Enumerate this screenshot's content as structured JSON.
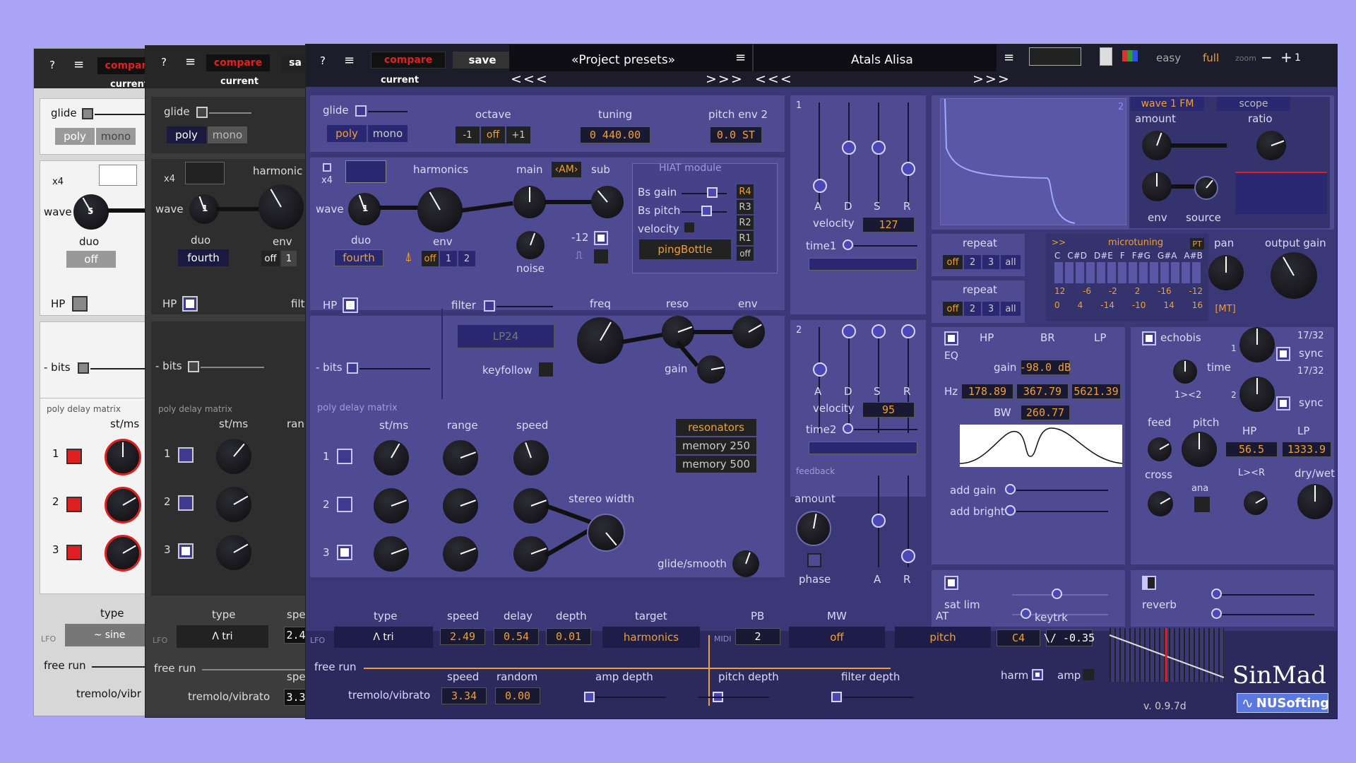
{
  "header": {
    "help": "?",
    "menu": "≡",
    "compare": "compare",
    "save": "save",
    "current": "current",
    "presets_bank": "«Project presets»",
    "preset_name": "Atals Alisa",
    "prev": "<<<",
    "next": ">>>",
    "easy": "easy",
    "full": "full",
    "zoom": "zoom",
    "zoom_out": "−",
    "zoom_in": "+",
    "zoom_val": "1"
  },
  "osc": {
    "glide": "glide",
    "poly": "poly",
    "mono": "mono",
    "octave": "octave",
    "oct_minus": "-1",
    "oct_off": "off",
    "oct_plus": "+1",
    "tuning": "tuning",
    "tuning_val": "0 440.00",
    "pitch_env": "pitch env 2",
    "pitch_env_val": "0.0 ST",
    "x4": "x4",
    "harmonics": "harmonics",
    "main": "main",
    "am": "‹AM›",
    "sub": "sub",
    "wave": "wave",
    "wave_num": "1",
    "duo": "duo",
    "duo_val": "fourth",
    "env": "env",
    "env_off": "off",
    "env_1": "1",
    "env_2": "2",
    "noise": "noise",
    "minus12": "-12"
  },
  "hiat": {
    "title": "HIAT module",
    "bs_gain": "Bs gain",
    "bs_pitch": "Bs pitch",
    "velocity": "velocity",
    "r4": "R4",
    "r3": "R3",
    "r2": "R2",
    "r1": "R1",
    "off": "off",
    "model": "pingBottle"
  },
  "filter": {
    "hp": "HP",
    "filter": "filter",
    "freq": "freq",
    "reso": "reso",
    "env": "env",
    "mode": "LP24",
    "bits": "- bits",
    "keyfollow": "keyfollow",
    "gain": "gain"
  },
  "delay": {
    "title": "poly delay matrix",
    "st_ms": "st/ms",
    "range": "range",
    "speed": "speed",
    "r1": "1",
    "r2": "2",
    "r3": "3",
    "stereo_width": "stereo width",
    "glide_smooth": "glide/smooth",
    "resonators": "resonators",
    "mem250": "memory 250",
    "mem500": "memory 500"
  },
  "env1": {
    "num": "1",
    "a": "A",
    "d": "D",
    "s": "S",
    "r": "R",
    "velocity": "velocity",
    "velocity_val": "127",
    "time": "time1"
  },
  "env2": {
    "num": "2",
    "a": "A",
    "d": "D",
    "s": "S",
    "r": "R",
    "velocity": "velocity",
    "velocity_val": "95",
    "time": "time2"
  },
  "feedback": {
    "title": "feedback",
    "amount": "amount",
    "phase": "phase",
    "a": "A",
    "r": "R"
  },
  "mod": {
    "num": "2",
    "wave_fm": "wave 1 FM",
    "scope": "scope",
    "amount": "amount",
    "ratio": "ratio",
    "env": "env",
    "source": "source"
  },
  "repeat1": {
    "label": "repeat",
    "off": "off",
    "v2": "2",
    "v3": "3",
    "all": "all"
  },
  "repeat2": {
    "label": "repeat",
    "off": "off",
    "v2": "2",
    "v3": "3",
    "all": "all"
  },
  "micro": {
    "title": "microtuning",
    "pt": "PT",
    "arrows": ">>",
    "notes": [
      "C",
      "C#D",
      "D#E",
      "F",
      "F#G",
      "G#A",
      "A#B"
    ],
    "row1": [
      "12",
      "-6",
      "-2",
      "2",
      "-16",
      "-12"
    ],
    "row2": [
      "0",
      "4",
      "-14",
      "-10",
      "14",
      "16"
    ],
    "mt": "[MT]"
  },
  "out": {
    "pan": "pan",
    "output_gain": "output gain"
  },
  "eq": {
    "eq": "EQ",
    "hp": "HP",
    "br": "BR",
    "lp": "LP",
    "gain": "gain",
    "gain_val": "-98.0 dB",
    "hz": "Hz",
    "hz1": "178.89",
    "hz2": "367.79",
    "hz3": "5621.39",
    "bw": "BW",
    "bw_val": "260.77",
    "add_gain": "add gain",
    "add_bright": "add bright"
  },
  "echo": {
    "title": "echobis",
    "t1": "17/32",
    "t2": "17/32",
    "sync": "sync",
    "sync2": "sync",
    "time": "time",
    "n1": "1",
    "n2": "2",
    "x12": "1><2",
    "feed": "feed",
    "pitch": "pitch",
    "hp": "HP",
    "lp": "LP",
    "hp_val": "56.5",
    "lp_val": "1333.9",
    "cross": "cross",
    "ana": "ana",
    "lr": "L><R",
    "drywet": "dry/wet"
  },
  "satlim": {
    "label": "sat lim"
  },
  "reverb": {
    "label": "reverb"
  },
  "lfo": {
    "lfo": "LFO",
    "type": "type",
    "type_val": "Λ tri",
    "speed": "speed",
    "speed_val": "2.49",
    "delay": "delay",
    "delay_val": "0.54",
    "depth": "depth",
    "depth_val": "0.01",
    "target": "target",
    "target_val": "harmonics",
    "free_run": "free run",
    "pb": "PB",
    "midi": "MIDI",
    "pb_val": "2",
    "mw": "MW",
    "mw_val": "off",
    "at": "AT",
    "at_val": "pitch",
    "keytrk": "keytrk",
    "keytrk_val": "C4",
    "keytrk_amt": "\\/ -0.35",
    "harm": "harm",
    "amp": "amp",
    "speed2": "speed",
    "random": "random",
    "tremolo": "tremolo/vibrato",
    "trem_speed": "3.34",
    "trem_random": "0.00",
    "amp_depth": "amp depth",
    "pitch_depth": "pitch depth",
    "filter_depth": "filter depth"
  },
  "brand": {
    "name": "SinMad",
    "company": "NUSofting",
    "version": "v. 0.9.7d"
  },
  "back1": {
    "help": "?",
    "menu": "≡",
    "compare": "compar",
    "current": "current",
    "glide": "glide",
    "poly": "poly",
    "mono": "mono",
    "x4": "x4",
    "wave": "wave",
    "wave_num": "5",
    "duo": "duo",
    "duo_val": "off",
    "hp": "HP",
    "bits": "- bits",
    "delay_title": "poly delay matrix",
    "st_ms": "st/ms",
    "r1": "1",
    "r2": "2",
    "r3": "3",
    "type": "type",
    "lfo": "LFO",
    "type_val": "~ sine",
    "free_run": "free run",
    "tremolo": "tremolo/vibr"
  },
  "back2": {
    "help": "?",
    "menu": "≡",
    "compare": "compare",
    "save": "sa",
    "current": "current",
    "glide": "glide",
    "poly": "poly",
    "mono": "mono",
    "x4": "x4",
    "harmonic": "harmonic",
    "wave": "wave",
    "wave_num": "1",
    "duo": "duo",
    "duo_val": "fourth",
    "env": "env",
    "env_off": "off",
    "env_1": "1",
    "hp": "HP",
    "filt": "filt",
    "bits": "- bits",
    "delay_title": "poly delay matrix",
    "st_ms": "st/ms",
    "ran": "ran",
    "r1": "1",
    "r2": "2",
    "r3": "3",
    "type": "type",
    "spe": "spe",
    "lfo": "LFO",
    "type_val": "Λ tri",
    "speed_val": "2.4",
    "free_run": "free run",
    "tremolo": "tremolo/vibrato",
    "spe2": "spe",
    "trem_val": "3.3"
  },
  "colors": {
    "bg": "#a9a4f6",
    "panel": "#4e4b93",
    "panel_dark": "#3a3877",
    "accent": "#f0a030",
    "red": "#e02020"
  }
}
